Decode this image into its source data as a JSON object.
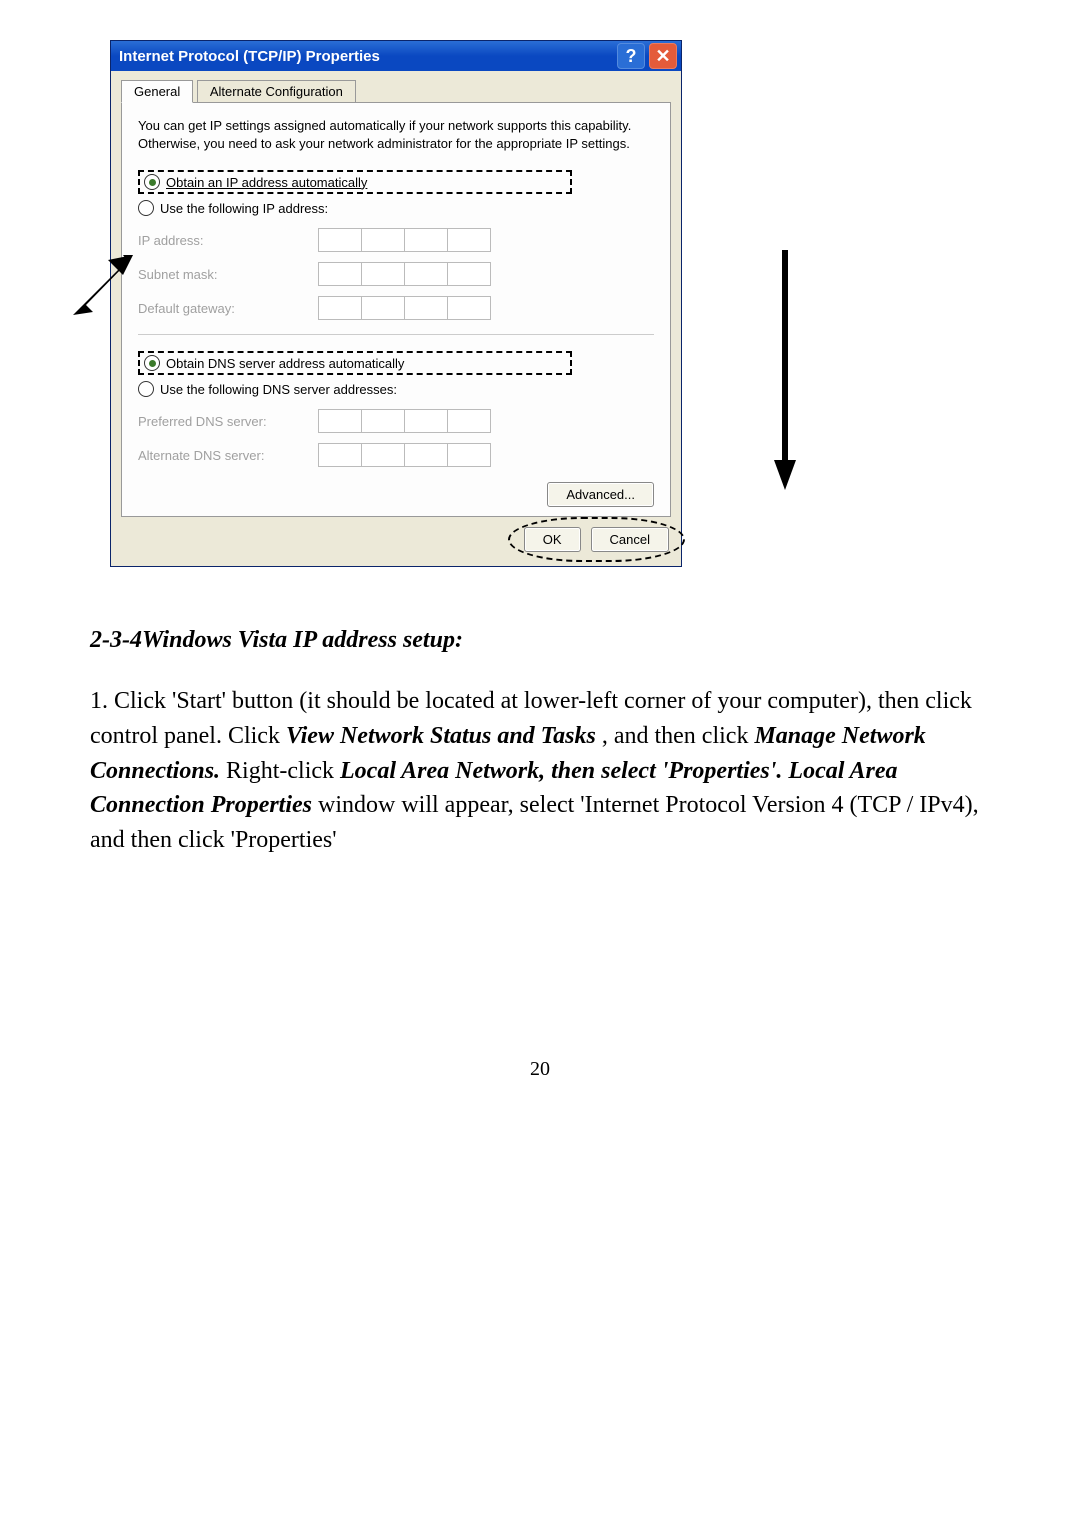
{
  "dialog": {
    "title": "Internet Protocol (TCP/IP) Properties",
    "help_glyph": "?",
    "close_glyph": "✕",
    "tabs": {
      "general": "General",
      "alt": "Alternate Configuration"
    },
    "description": "You can get IP settings assigned automatically if your network supports this capability. Otherwise, you need to ask your network administrator for the appropriate IP settings.",
    "radio_obtain_ip": "Obtain an IP address automatically",
    "radio_use_ip": "Use the following IP address:",
    "lbl_ip": "IP address:",
    "lbl_subnet": "Subnet mask:",
    "lbl_gateway": "Default gateway:",
    "radio_obtain_dns": "Obtain DNS server address automatically",
    "radio_use_dns": "Use the following DNS server addresses:",
    "lbl_pref_dns": "Preferred DNS server:",
    "lbl_alt_dns": "Alternate DNS server:",
    "btn_advanced": "Advanced...",
    "btn_ok": "OK",
    "btn_cancel": "Cancel"
  },
  "doc": {
    "heading": "2-3-4Windows Vista IP address setup:",
    "para_1a": "1. Click 'Start' button (it should be located at lower-left corner of your computer), then click control panel. Click ",
    "para_1b": "View Network Status and Tasks",
    "para_1c": ", and then click ",
    "para_1d": "Manage Network Connections.",
    "para_1e": " Right-click ",
    "para_1f": "Local Area Network, then select 'Properties'. Local Area Connection Properties",
    "para_1g": " window will appear, select 'Internet Protocol Version 4 (TCP / IPv4), and then click 'Properties'",
    "page_number": "20"
  }
}
